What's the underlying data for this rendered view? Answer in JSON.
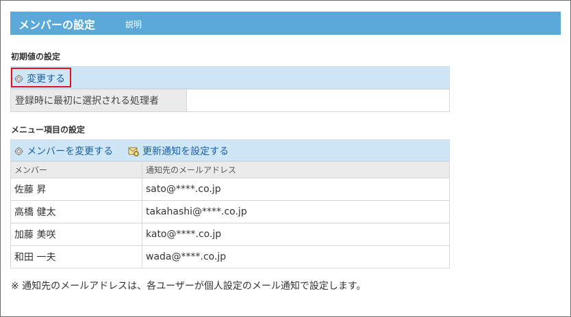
{
  "header": {
    "title": "メンバーの設定",
    "help_link": "説明"
  },
  "initial": {
    "section_title": "初期値の設定",
    "change_link": "変更する",
    "row_label": "登録時に最初に選択される処理者",
    "row_value": ""
  },
  "menu": {
    "section_title": "メニュー項目の設定",
    "change_members_link": "メンバーを変更する",
    "notify_settings_link": "更新通知を設定する",
    "columns": [
      "メンバー",
      "通知先のメールアドレス"
    ],
    "rows": [
      {
        "member": "佐藤 昇",
        "email": "sato@****.co.jp"
      },
      {
        "member": "高橋 健太",
        "email": "takahashi@****.co.jp"
      },
      {
        "member": "加藤 美咲",
        "email": "kato@****.co.jp"
      },
      {
        "member": "和田 一夫",
        "email": "wada@****.co.jp"
      }
    ]
  },
  "note": "※ 通知先のメールアドレスは、各ユーザーが個人設定のメール通知で設定します。",
  "colors": {
    "header_bg": "#5ba9d9",
    "toolbar_bg": "#cfe6f7",
    "link": "#1a5fa6",
    "highlight": "#e0111f"
  }
}
